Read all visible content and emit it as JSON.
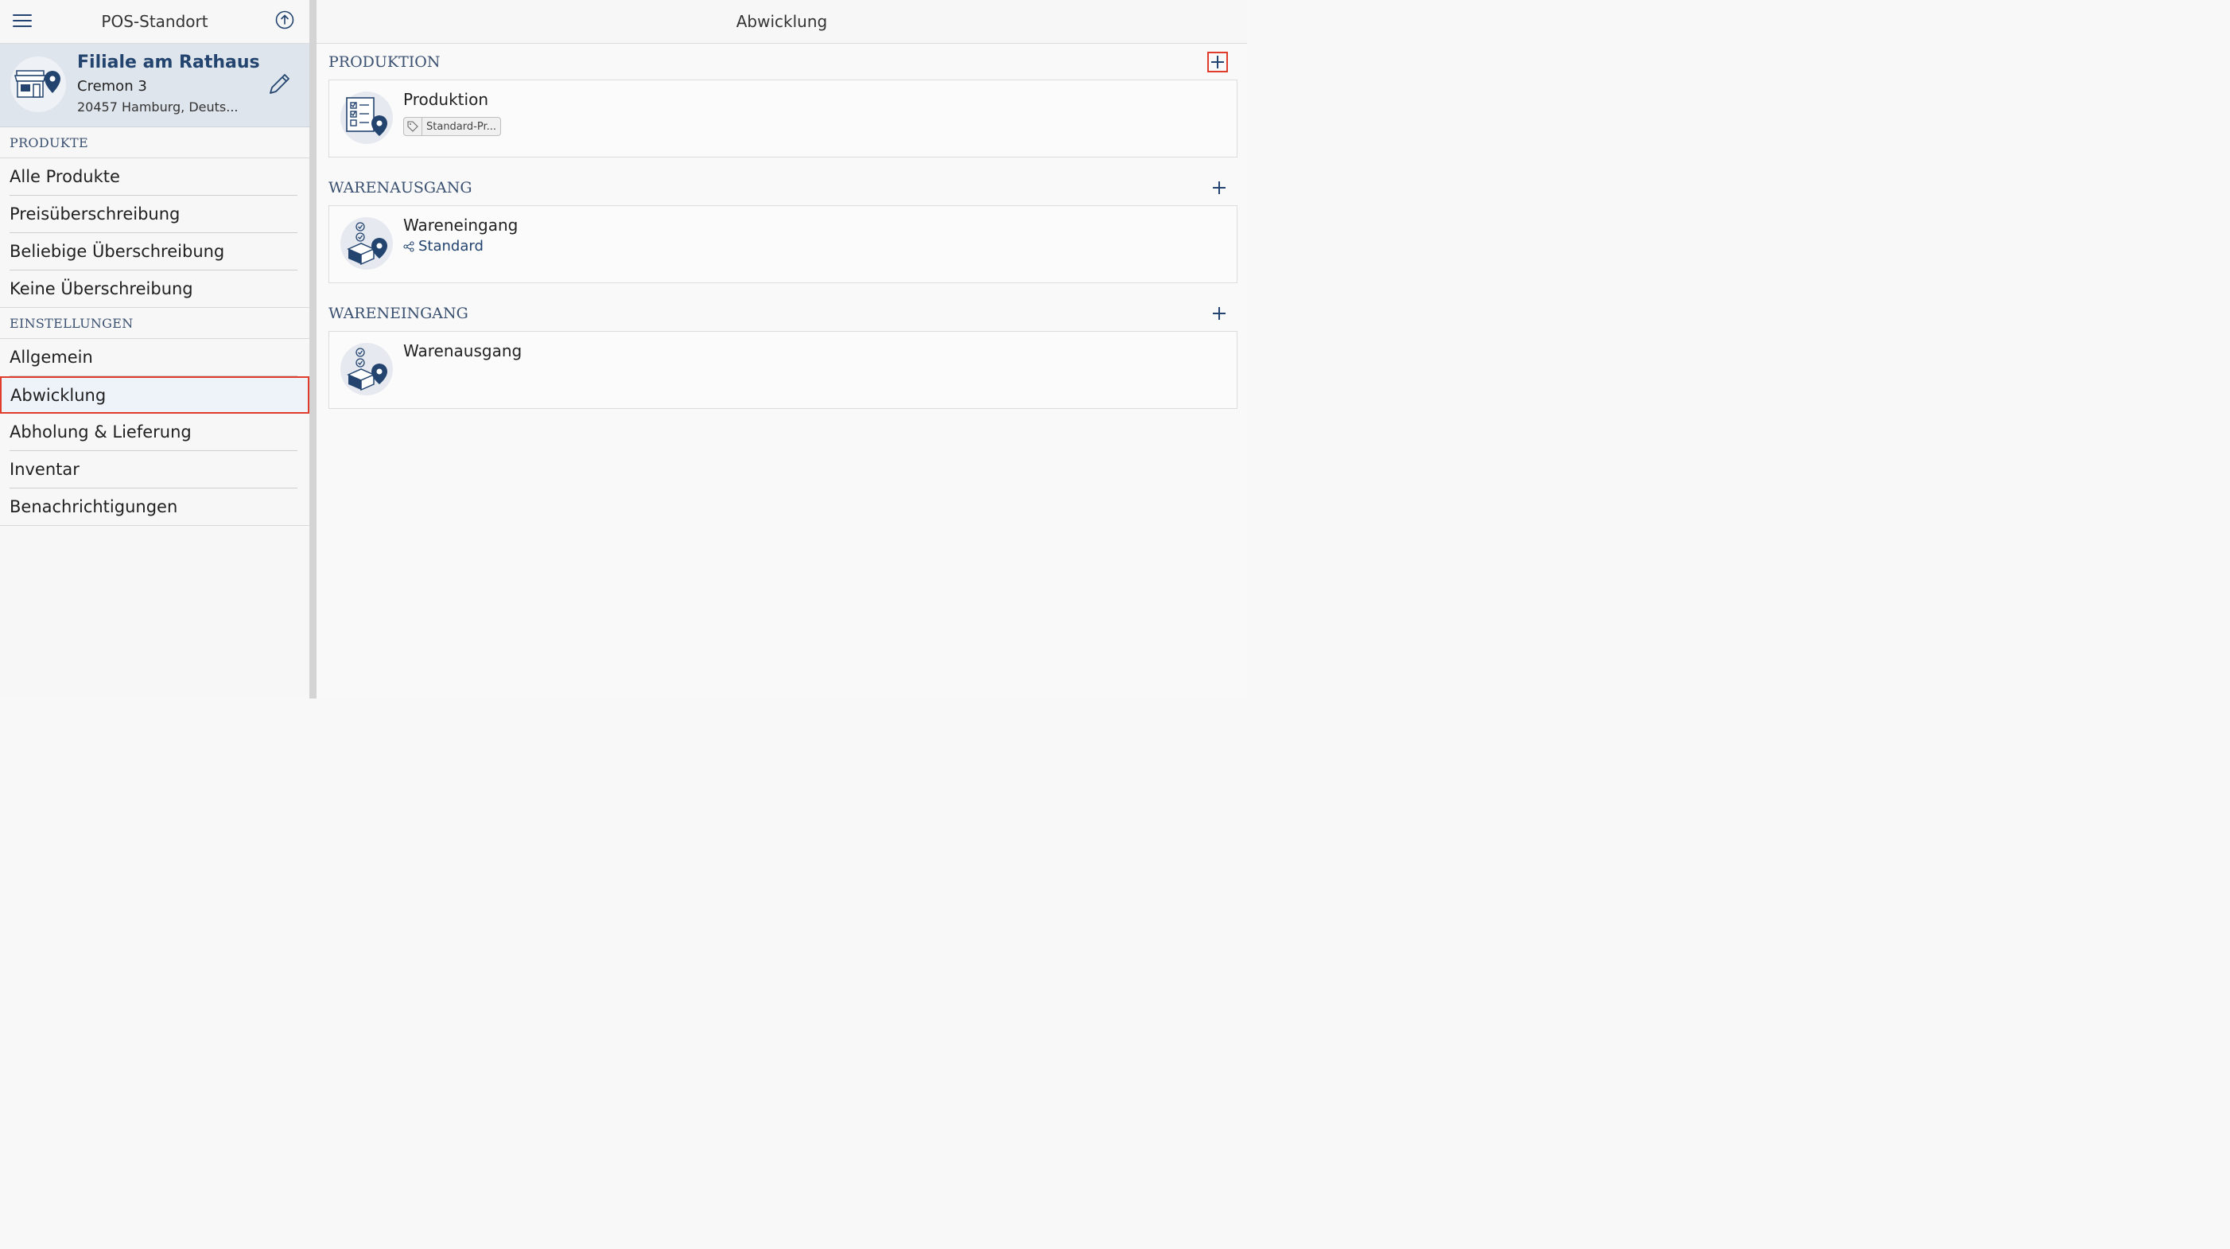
{
  "sidebar": {
    "title": "POS-Standort",
    "location": {
      "name": "Filiale am Rathaus",
      "street": "Cremon 3",
      "city": "20457 Hamburg, Deuts..."
    },
    "sections": [
      {
        "header": "PRODUKTE",
        "items": [
          "Alle Produkte",
          "Preisüberschreibung",
          "Beliebige Überschreibung",
          "Keine Überschreibung"
        ]
      },
      {
        "header": "EINSTELLUNGEN",
        "items": [
          "Allgemein",
          "Abwicklung",
          "Abholung & Lieferung",
          "Inventar",
          "Benachrichtigungen"
        ]
      }
    ],
    "selected_item": "Abwicklung"
  },
  "main": {
    "title": "Abwicklung",
    "groups": [
      {
        "header": "PRODUKTION",
        "card": {
          "title": "Produktion",
          "tag": "Standard-Pr..."
        }
      },
      {
        "header": "WARENAUSGANG",
        "card": {
          "title": "Wareneingang",
          "sub": "Standard"
        }
      },
      {
        "header": "WARENEINGANG",
        "card": {
          "title": "Warenausgang"
        }
      }
    ]
  },
  "colors": {
    "accent": "#23446f",
    "highlight": "#e03c2c",
    "location_bg": "#dfe5ec"
  }
}
